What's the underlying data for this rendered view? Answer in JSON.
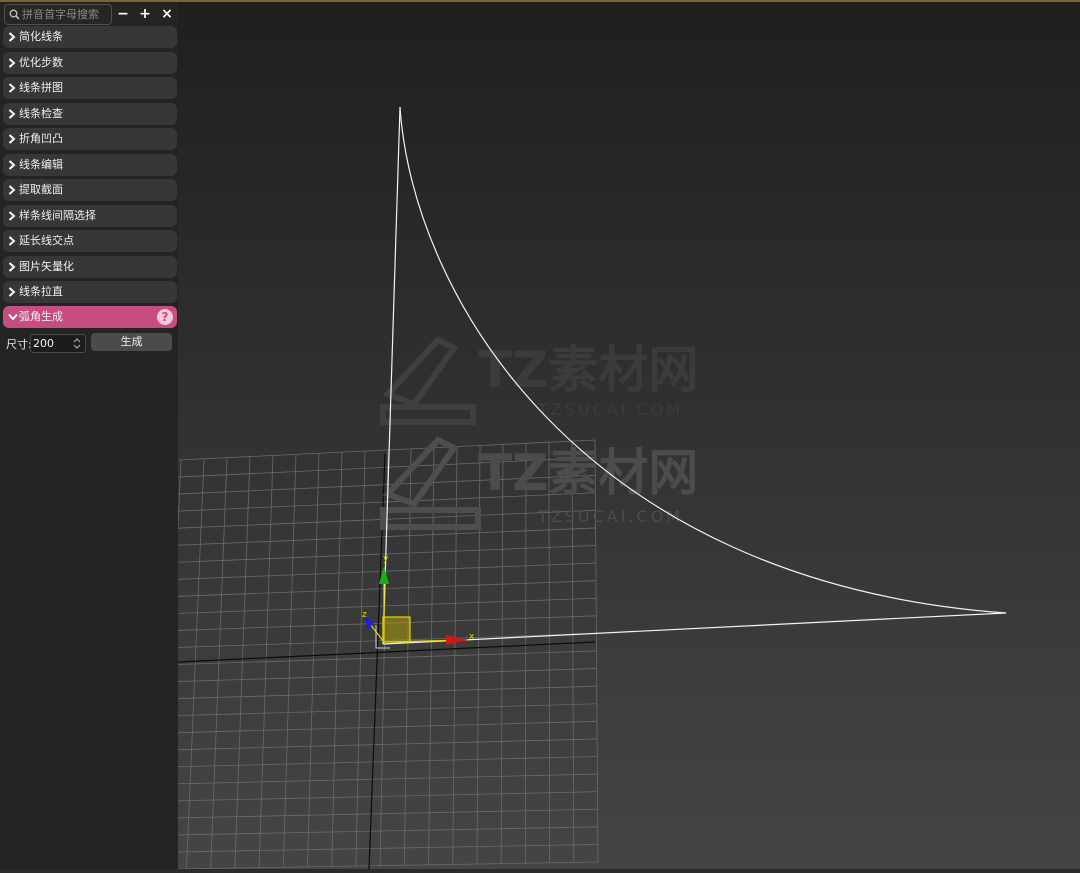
{
  "search": {
    "placeholder": "拼音首字母搜索"
  },
  "window_controls": {
    "minimize": "−",
    "add": "+",
    "close": "×"
  },
  "menu": {
    "items": [
      {
        "label": "简化线条"
      },
      {
        "label": "优化步数"
      },
      {
        "label": "线条拼图"
      },
      {
        "label": "线条检查"
      },
      {
        "label": "折角凹凸"
      },
      {
        "label": "线条编辑"
      },
      {
        "label": "提取截面"
      },
      {
        "label": "样条线间隔选择"
      },
      {
        "label": "延长线交点"
      },
      {
        "label": "图片矢量化"
      },
      {
        "label": "线条拉直"
      }
    ],
    "active": {
      "label": "弧角生成",
      "help": "?"
    }
  },
  "arc_panel": {
    "size_label": "尺寸:",
    "size_value": "200",
    "generate_label": "生成"
  },
  "viewport": {
    "gizmo_axes": {
      "x": "x",
      "y": "y",
      "z": "z"
    },
    "watermarks": [
      {
        "brand": "TZ素材网",
        "url": "TZSUCAI.COM"
      },
      {
        "brand": "TZ素材网",
        "url": "TZSUCAI.COM"
      }
    ]
  },
  "colors": {
    "panel_bg": "#242424",
    "item_bg": "#373737",
    "active_accent": "#c64d82",
    "top_border": "#7a6430"
  }
}
